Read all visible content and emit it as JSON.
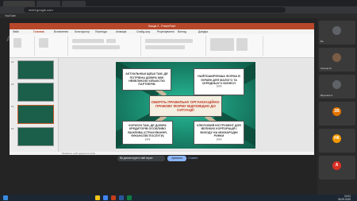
{
  "browser": {
    "url": "meet.google.com",
    "bookmark": "YouTube"
  },
  "watermark": "Aitri",
  "powerpoint": {
    "title": "Лекція 2 - PowerPoint",
    "menu": [
      "Файл",
      "Головна",
      "Вставлення",
      "Конструктор",
      "Переходи",
      "Анімація",
      "Слайд-шоу",
      "Рецензування",
      "Вигляд",
      "Довідка"
    ],
    "thumb_numbers": [
      "12",
      "13",
      "14",
      "15"
    ],
    "notes_placeholder": "Примітки, щоб додати нотатки"
  },
  "slide": {
    "top_left": "АКТУАЛЬНІШІ ЩЕШІ ТАМ, ДЕ ПОТРІБНА ДОВІРА МІЖ НЕВЕЛИКОЮ КІЛЬКІСТЮ ПАРТНЕРІВ",
    "top_right": "НАЙПОШИРЕНІША ФОРМА В УКРАЇНІ ДЛЯ МАЛОГО ТА СЕРЕДНЬОГО БІЗНЕСУ",
    "top_right_q": "???",
    "center": "ОБЕРІТЬ ПРАВИЛЬНУ ОРГАНІЗАЦІЙНО-ПРАВОВУ ФОРМУ ВІДПОВІДНО ДО СИТУАЦІЇ!",
    "bottom_left": "КОРИСНІ ТАМ, ДЕ ДОВІРА КРЕДИТОРІВ ОСОБЛИВО ВАЖЛИВА (СТРАХУВАННЯ, ФІНАНСОВІ ПОСЛУГИ)",
    "bottom_left_q": "???",
    "bottom_right": "КЛЮЧОВИЙ ІНСТРУМЕНТ ДЛЯ ВЕЛИКИХ КОРПОРАЦІЙ І ВИХОДУ НА МІЖНАРОДНІ РИНКИ",
    "bottom_right_q": "???"
  },
  "meet": {
    "presenting_text": "Ви демонструєте свій екран",
    "stop_label": "Зупинити",
    "hide_label": "Сховати"
  },
  "participants": [
    {
      "name": "Ви",
      "initial": "",
      "color": "#5f6368"
    },
    {
      "name": "Оксана М.",
      "initial": "",
      "color": "#7a5c45"
    },
    {
      "name": "Вероніка С.",
      "initial": "",
      "color": "#5f6368"
    },
    {
      "name": "",
      "initial": "ЗВ",
      "color": "#e37400"
    },
    {
      "name": "",
      "initial": "НК",
      "color": "#f29900"
    },
    {
      "name": "",
      "initial": "А",
      "color": "#d93025"
    }
  ],
  "taskbar": {
    "time": "10:01",
    "date": "06.09.2025"
  },
  "colors": {
    "accent_ppt": "#b7472a",
    "slide_green": "#1b8f73",
    "meet_blue": "#8ab4f8"
  }
}
